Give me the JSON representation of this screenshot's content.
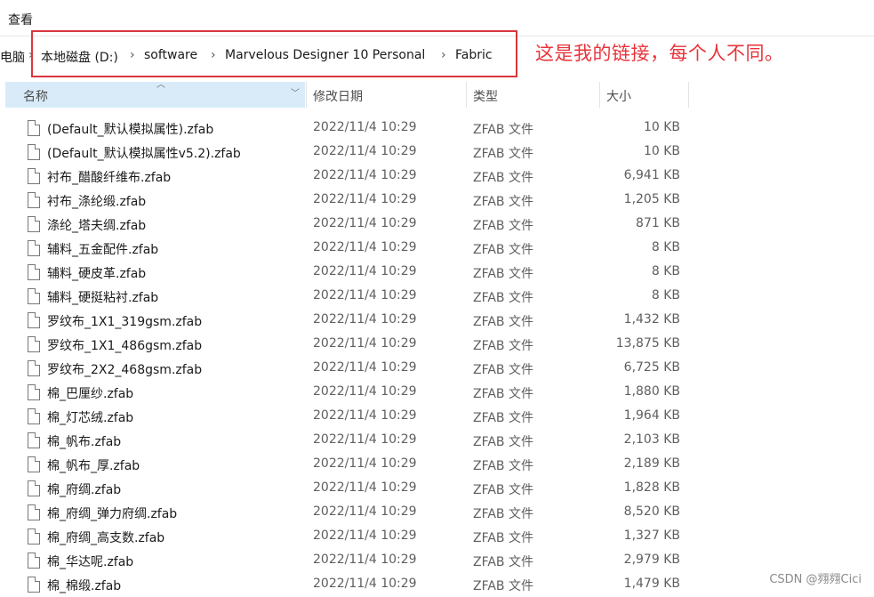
{
  "menu": {
    "view": "查看"
  },
  "address": {
    "fragment": "电脑",
    "crumbs": [
      "本地磁盘 (D:)",
      "software",
      "Marvelous Designer 10 Personal",
      "Fabric"
    ],
    "separator": "›"
  },
  "annotation": "这是我的链接，每个人不同。",
  "columns": {
    "name": "名称",
    "date": "修改日期",
    "type": "类型",
    "size": "大小"
  },
  "files": [
    {
      "name": "(Default_默认模拟属性).zfab",
      "date": "2022/11/4 10:29",
      "type": "ZFAB 文件",
      "size": "10 KB"
    },
    {
      "name": "(Default_默认模拟属性v5.2).zfab",
      "date": "2022/11/4 10:29",
      "type": "ZFAB 文件",
      "size": "10 KB"
    },
    {
      "name": "衬布_醋酸纤维布.zfab",
      "date": "2022/11/4 10:29",
      "type": "ZFAB 文件",
      "size": "6,941 KB"
    },
    {
      "name": "衬布_涤纶缎.zfab",
      "date": "2022/11/4 10:29",
      "type": "ZFAB 文件",
      "size": "1,205 KB"
    },
    {
      "name": "涤纶_塔夫绸.zfab",
      "date": "2022/11/4 10:29",
      "type": "ZFAB 文件",
      "size": "871 KB"
    },
    {
      "name": "辅料_五金配件.zfab",
      "date": "2022/11/4 10:29",
      "type": "ZFAB 文件",
      "size": "8 KB"
    },
    {
      "name": "辅料_硬皮革.zfab",
      "date": "2022/11/4 10:29",
      "type": "ZFAB 文件",
      "size": "8 KB"
    },
    {
      "name": "辅料_硬挺粘衬.zfab",
      "date": "2022/11/4 10:29",
      "type": "ZFAB 文件",
      "size": "8 KB"
    },
    {
      "name": "罗纹布_1X1_319gsm.zfab",
      "date": "2022/11/4 10:29",
      "type": "ZFAB 文件",
      "size": "1,432 KB"
    },
    {
      "name": "罗纹布_1X1_486gsm.zfab",
      "date": "2022/11/4 10:29",
      "type": "ZFAB 文件",
      "size": "13,875 KB"
    },
    {
      "name": "罗纹布_2X2_468gsm.zfab",
      "date": "2022/11/4 10:29",
      "type": "ZFAB 文件",
      "size": "6,725 KB"
    },
    {
      "name": "棉_巴厘纱.zfab",
      "date": "2022/11/4 10:29",
      "type": "ZFAB 文件",
      "size": "1,880 KB"
    },
    {
      "name": "棉_灯芯绒.zfab",
      "date": "2022/11/4 10:29",
      "type": "ZFAB 文件",
      "size": "1,964 KB"
    },
    {
      "name": "棉_帆布.zfab",
      "date": "2022/11/4 10:29",
      "type": "ZFAB 文件",
      "size": "2,103 KB"
    },
    {
      "name": "棉_帆布_厚.zfab",
      "date": "2022/11/4 10:29",
      "type": "ZFAB 文件",
      "size": "2,189 KB"
    },
    {
      "name": "棉_府绸.zfab",
      "date": "2022/11/4 10:29",
      "type": "ZFAB 文件",
      "size": "1,828 KB"
    },
    {
      "name": "棉_府绸_弹力府绸.zfab",
      "date": "2022/11/4 10:29",
      "type": "ZFAB 文件",
      "size": "8,520 KB"
    },
    {
      "name": "棉_府绸_高支数.zfab",
      "date": "2022/11/4 10:29",
      "type": "ZFAB 文件",
      "size": "1,327 KB"
    },
    {
      "name": "棉_华达呢.zfab",
      "date": "2022/11/4 10:29",
      "type": "ZFAB 文件",
      "size": "2,979 KB"
    },
    {
      "name": "棉_棉缎.zfab",
      "date": "2022/11/4 10:29",
      "type": "ZFAB 文件",
      "size": "1,479 KB"
    }
  ],
  "watermark": "CSDN @翙翙Cici"
}
